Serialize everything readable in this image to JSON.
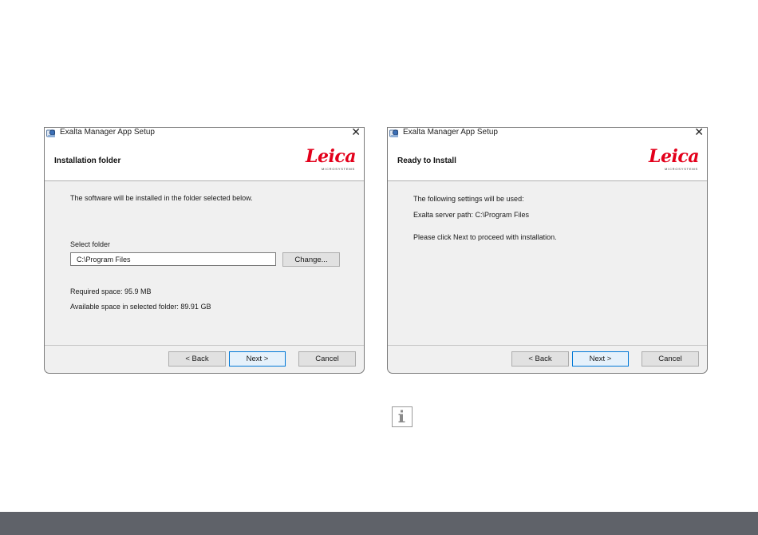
{
  "dialogs": [
    {
      "window_title": "Exalta Manager App Setup",
      "header_title": "Installation folder",
      "intro_text": "The software will be installed in the folder selected below.",
      "select_folder_label": "Select folder",
      "folder_path_value": "C:\\Program Files",
      "change_button_label": "Change...",
      "required_space": "Required space: 95.9 MB",
      "available_space": "Available space in selected folder: 89.91 GB",
      "back_label": "< Back",
      "next_label": "Next >",
      "cancel_label": "Cancel"
    },
    {
      "window_title": "Exalta Manager App Setup",
      "header_title": "Ready to Install",
      "settings_text": "The following settings will be used:",
      "server_path_text": "Exalta server path: C:\\Program Files",
      "proceed_text": "Please click Next to proceed with installation.",
      "back_label": "< Back",
      "next_label": "Next >",
      "cancel_label": "Cancel"
    }
  ],
  "logo": {
    "word": "Leica",
    "subtitle": "MICROSYSTEMS",
    "color": "#e3001b"
  },
  "icons": {
    "app_icon": "installer-app-icon",
    "close": "close-icon",
    "info": "info-icon"
  },
  "colors": {
    "dialog_body": "#f0f0f0",
    "primary_button_border": "#0078d7",
    "bottom_bar": "#5f6269"
  }
}
